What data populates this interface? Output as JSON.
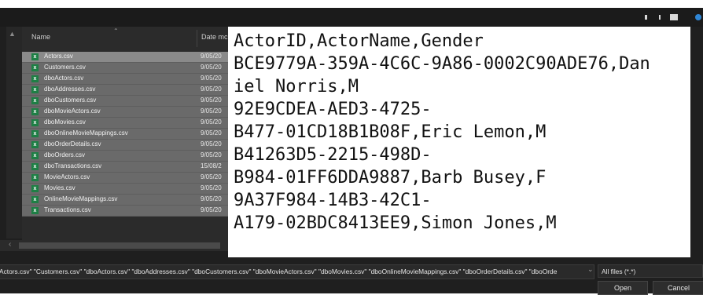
{
  "columns": {
    "name": "Name",
    "date": "Date mc"
  },
  "files": [
    {
      "name": "Actors.csv",
      "date": "9/05/20"
    },
    {
      "name": "Customers.csv",
      "date": "9/05/20"
    },
    {
      "name": "dboActors.csv",
      "date": "9/05/20"
    },
    {
      "name": "dboAddresses.csv",
      "date": "9/05/20"
    },
    {
      "name": "dboCustomers.csv",
      "date": "9/05/20"
    },
    {
      "name": "dboMovieActors.csv",
      "date": "9/05/20"
    },
    {
      "name": "dboMovies.csv",
      "date": "9/05/20"
    },
    {
      "name": "dboOnlineMovieMappings.csv",
      "date": "9/05/20"
    },
    {
      "name": "dboOrderDetails.csv",
      "date": "9/05/20"
    },
    {
      "name": "dboOrders.csv",
      "date": "9/05/20"
    },
    {
      "name": "dboTransactions.csv",
      "date": "15/08/2"
    },
    {
      "name": "MovieActors.csv",
      "date": "9/05/20"
    },
    {
      "name": "Movies.csv",
      "date": "9/05/20"
    },
    {
      "name": "OnlineMovieMappings.csv",
      "date": "9/05/20"
    },
    {
      "name": "Transactions.csv",
      "date": "9/05/20"
    }
  ],
  "file_icon_letter": "x",
  "preview_lines": [
    "ActorID,ActorName,Gender",
    "BCE9779A-359A-4C6C-9A86-0002C90ADE76,Dan",
    "iel Norris,M",
    "92E9CDEA-AED3-4725-",
    "B477-01CD18B1B08F,Eric Lemon,M",
    "B41263D5-2215-498D-",
    "B984-01FF6DDA9887,Barb Busey,F",
    "9A37F984-14B3-42C1-",
    "A179-02BDC8413EE9,Simon Jones,M"
  ],
  "filename_value": "Actors.csv\" \"Customers.csv\" \"dboActors.csv\" \"dboAddresses.csv\" \"dboCustomers.csv\" \"dboMovieActors.csv\" \"dboMovies.csv\" \"dboOnlineMovieMappings.csv\" \"dboOrderDetails.csv\" \"dboOrde",
  "filter_value": "All files (*.*)",
  "open_label": "Open",
  "cancel_label": "Cancel",
  "colors": {
    "selected_row": "#8a8a8a",
    "row": "#6a6a6a",
    "excel_green": "#1e7f45",
    "accent": "#2f86d6"
  }
}
